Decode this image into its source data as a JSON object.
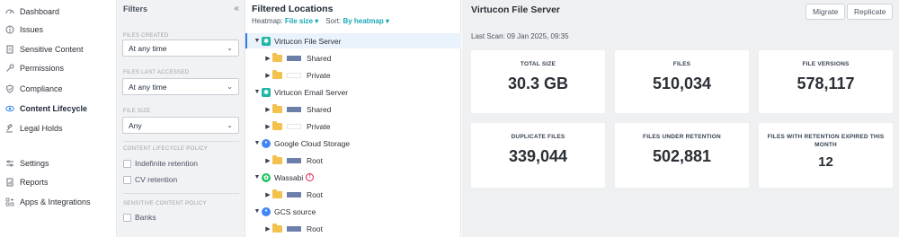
{
  "nav": {
    "items": [
      {
        "label": "Dashboard",
        "icon": "dashboard-icon"
      },
      {
        "label": "Issues",
        "icon": "info-circle-icon"
      },
      {
        "label": "Sensitive Content",
        "icon": "document-icon"
      },
      {
        "label": "Permissions",
        "icon": "key-icon"
      },
      {
        "label": "Compliance",
        "icon": "shield-check-icon"
      },
      {
        "label": "Content Lifecycle",
        "icon": "lifecycle-icon",
        "active": true
      },
      {
        "label": "Legal Holds",
        "icon": "gavel-icon"
      },
      {
        "label": "Settings",
        "icon": "sliders-icon"
      },
      {
        "label": "Reports",
        "icon": "report-icon"
      },
      {
        "label": "Apps & Integrations",
        "icon": "apps-icon"
      }
    ]
  },
  "filters": {
    "title": "Filters",
    "collapse_glyph": "«",
    "files_created": {
      "label": "FILES CREATED",
      "value": "At any time"
    },
    "files_last_accessed": {
      "label": "FILES LAST ACCESSED",
      "value": "At any time"
    },
    "file_size": {
      "label": "FILE SIZE",
      "value": "Any"
    },
    "lifecycle_policy": {
      "label": "CONTENT LIFECYCLE POLICY",
      "options": [
        "Indefinite retention",
        "CV retention"
      ]
    },
    "sensitive_policy": {
      "label": "SENSITIVE CONTENT POLICY",
      "options": [
        "Banks"
      ]
    }
  },
  "tree": {
    "title": "Filtered Locations",
    "heatmap_label": "Heatmap:",
    "heatmap_value": "File size ▾",
    "sort_label": "Sort:",
    "sort_value": "By heatmap ▾",
    "rows": [
      {
        "label": "Virtucon File Server",
        "level": 0,
        "expanded": true,
        "type": "server",
        "selected": true
      },
      {
        "label": "Shared",
        "level": 1,
        "type": "folder",
        "heat": "#6b7fa8"
      },
      {
        "label": "Private",
        "level": 1,
        "type": "folder",
        "heat": "#ffffff"
      },
      {
        "label": "Virtucon Email Server",
        "level": 0,
        "expanded": true,
        "type": "server"
      },
      {
        "label": "Shared",
        "level": 1,
        "type": "folder",
        "heat": "#6b7fa8"
      },
      {
        "label": "Private",
        "level": 1,
        "type": "folder",
        "heat": "#ffffff"
      },
      {
        "label": "Google Cloud Storage",
        "level": 0,
        "expanded": true,
        "type": "gcs"
      },
      {
        "label": "Root",
        "level": 1,
        "type": "folder",
        "heat": "#6b7fa8"
      },
      {
        "label": "Wassabi",
        "level": 0,
        "expanded": true,
        "type": "wasabi",
        "alert": "!"
      },
      {
        "label": "Root",
        "level": 1,
        "type": "folder",
        "heat": "#6b7fa8"
      },
      {
        "label": "GCS source",
        "level": 0,
        "expanded": true,
        "type": "gcs"
      },
      {
        "label": "Root",
        "level": 1,
        "type": "folder",
        "heat": "#6b7fa8"
      }
    ]
  },
  "main": {
    "title": "Virtucon File Server",
    "migrate_label": "Migrate",
    "replicate_label": "Replicate",
    "last_scan": "Last Scan: 09 Jan 2025, 09:35",
    "cards": [
      {
        "label": "TOTAL SIZE",
        "value": "30.3 GB"
      },
      {
        "label": "FILES",
        "value": "510,034"
      },
      {
        "label": "FILE VERSIONS",
        "value": "578,117"
      },
      {
        "label": "DUPLICATE FILES",
        "value": "339,044"
      },
      {
        "label": "FILES UNDER RETENTION",
        "value": "502,881"
      },
      {
        "label": "FILES WITH RETENTION EXPIRED THIS MONTH",
        "value": "12"
      }
    ]
  },
  "colors": {
    "accent": "#16a9b6",
    "brand_blue": "#2a7de1",
    "heat_bar": "#6b7fa8",
    "alert": "#e11d48"
  }
}
